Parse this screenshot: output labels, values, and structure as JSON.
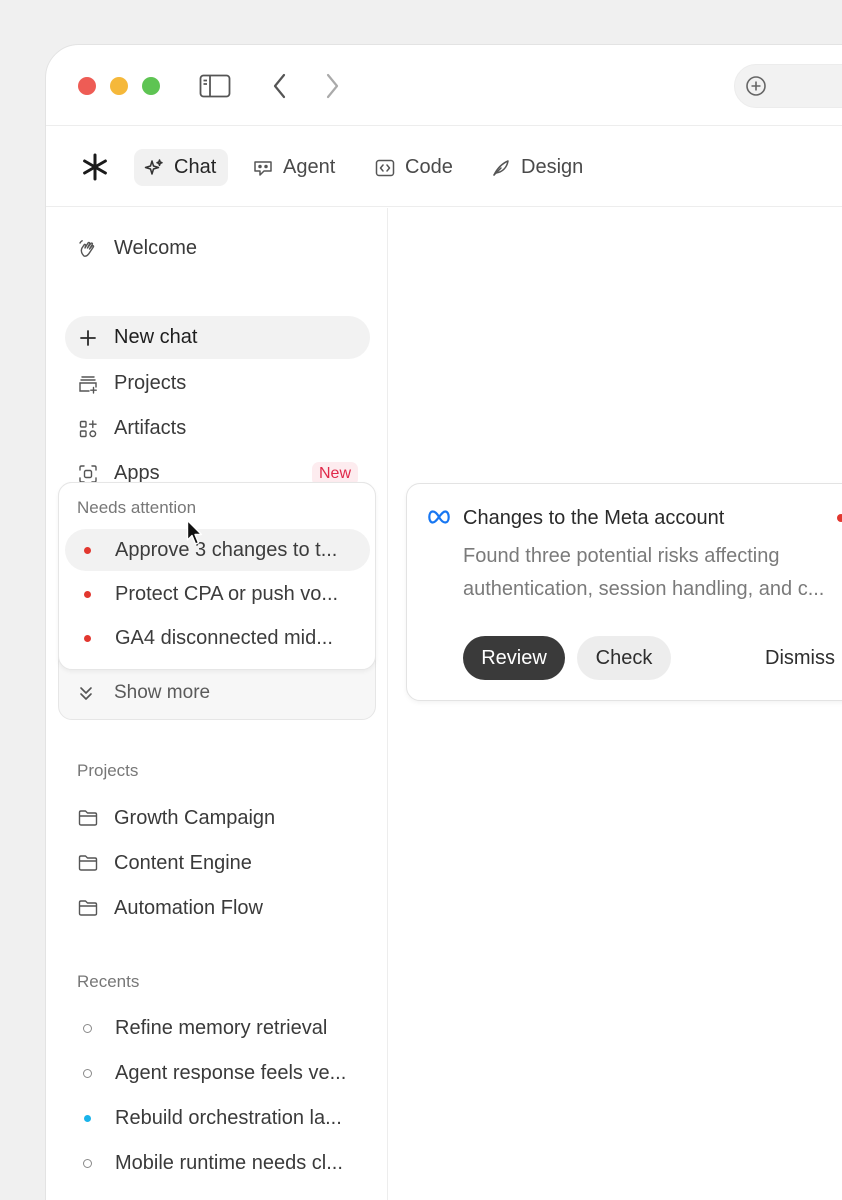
{
  "nav": {
    "tabs": [
      {
        "label": "Chat",
        "icon": "sparkle-icon",
        "active": true
      },
      {
        "label": "Agent",
        "icon": "agent-chat-icon",
        "active": false
      },
      {
        "label": "Code",
        "icon": "code-icon",
        "active": false
      },
      {
        "label": "Design",
        "icon": "feather-icon",
        "active": false
      }
    ]
  },
  "sidebar": {
    "items": [
      {
        "label": "Welcome",
        "icon": "wave-hand-icon"
      },
      {
        "label": "New chat",
        "icon": "plus-icon"
      },
      {
        "label": "Projects",
        "icon": "projects-icon"
      },
      {
        "label": "Artifacts",
        "icon": "artifacts-icon"
      },
      {
        "label": "Apps",
        "icon": "apps-icon",
        "badge": "New"
      }
    ],
    "attention": {
      "title": "Needs attention",
      "items": [
        "Approve 3 changes to t...",
        "Protect CPA or push vo...",
        "GA4 disconnected mid..."
      ],
      "show_more": "Show more"
    },
    "projects": {
      "title": "Projects",
      "items": [
        "Growth Campaign",
        "Content Engine",
        "Automation Flow"
      ]
    },
    "recents": {
      "title": "Recents",
      "items": [
        {
          "label": "Refine memory retrieval",
          "status": "idle"
        },
        {
          "label": "Agent response feels ve...",
          "status": "idle"
        },
        {
          "label": "Rebuild orchestration la...",
          "status": "active"
        },
        {
          "label": "Mobile runtime needs cl...",
          "status": "idle"
        }
      ]
    }
  },
  "card": {
    "icon": "meta-icon",
    "title": "Changes to the Meta account",
    "description_line1": "Found three potential risks affecting",
    "description_line2": "authentication, session handling, and c...",
    "review_label": "Review",
    "check_label": "Check",
    "dismiss_label": "Dismiss"
  },
  "colors": {
    "alert_red": "#e2372f",
    "active_blue": "#1ab3ea",
    "new_badge_text": "#e0294a",
    "primary_button": "#3a3a3a"
  }
}
